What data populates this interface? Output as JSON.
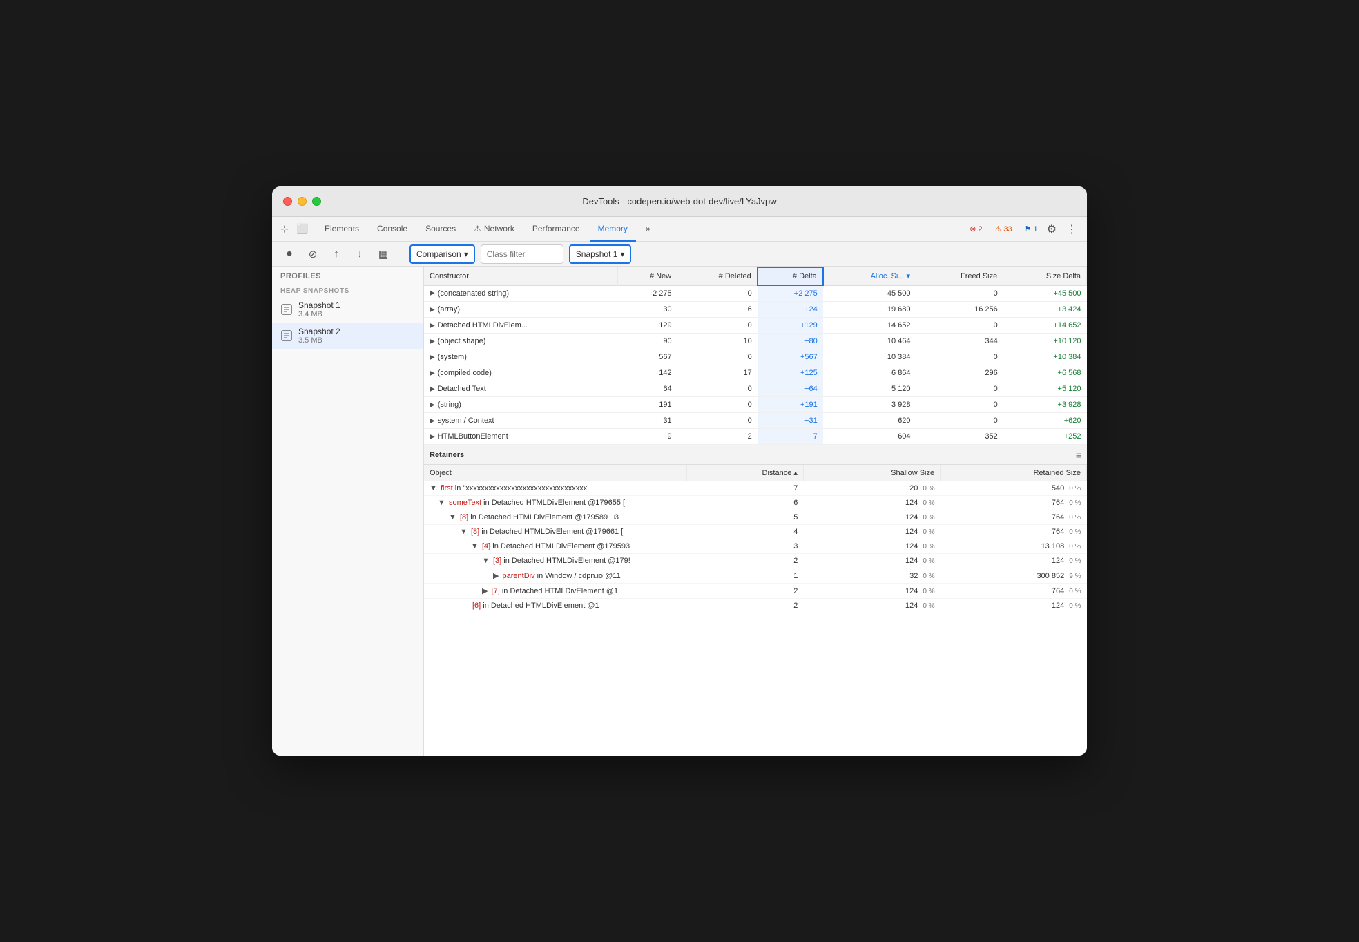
{
  "window": {
    "title": "DevTools - codepen.io/web-dot-dev/live/LYaJvpw"
  },
  "tabs": [
    {
      "label": "Elements",
      "active": false
    },
    {
      "label": "Console",
      "active": false
    },
    {
      "label": "Sources",
      "active": false
    },
    {
      "label": "⚠ Network",
      "active": false,
      "has_warning": true
    },
    {
      "label": "Performance",
      "active": false
    },
    {
      "label": "Memory",
      "active": true
    },
    {
      "label": "»",
      "active": false
    }
  ],
  "badges": {
    "error": "2",
    "warning": "33",
    "info": "1"
  },
  "toolbar": {
    "comparison_label": "Comparison",
    "class_filter_placeholder": "Class filter",
    "snapshot_label": "Snapshot 1"
  },
  "table": {
    "headers": [
      "Constructor",
      "# New",
      "# Deleted",
      "# Delta",
      "Alloc. Si...",
      "Freed Size",
      "Size Delta"
    ],
    "rows": [
      {
        "constructor": "(concatenated string)",
        "new": "2 275",
        "deleted": "0",
        "delta": "+2 275",
        "alloc_size": "45 500",
        "freed_size": "0",
        "size_delta": "+45 500"
      },
      {
        "constructor": "(array)",
        "new": "30",
        "deleted": "6",
        "delta": "+24",
        "alloc_size": "19 680",
        "freed_size": "16 256",
        "size_delta": "+3 424"
      },
      {
        "constructor": "Detached HTMLDivElem...",
        "new": "129",
        "deleted": "0",
        "delta": "+129",
        "alloc_size": "14 652",
        "freed_size": "0",
        "size_delta": "+14 652"
      },
      {
        "constructor": "(object shape)",
        "new": "90",
        "deleted": "10",
        "delta": "+80",
        "alloc_size": "10 464",
        "freed_size": "344",
        "size_delta": "+10 120"
      },
      {
        "constructor": "(system)",
        "new": "567",
        "deleted": "0",
        "delta": "+567",
        "alloc_size": "10 384",
        "freed_size": "0",
        "size_delta": "+10 384"
      },
      {
        "constructor": "(compiled code)",
        "new": "142",
        "deleted": "17",
        "delta": "+125",
        "alloc_size": "6 864",
        "freed_size": "296",
        "size_delta": "+6 568"
      },
      {
        "constructor": "Detached Text",
        "new": "64",
        "deleted": "0",
        "delta": "+64",
        "alloc_size": "5 120",
        "freed_size": "0",
        "size_delta": "+5 120"
      },
      {
        "constructor": "(string)",
        "new": "191",
        "deleted": "0",
        "delta": "+191",
        "alloc_size": "3 928",
        "freed_size": "0",
        "size_delta": "+3 928"
      },
      {
        "constructor": "system / Context",
        "new": "31",
        "deleted": "0",
        "delta": "+31",
        "alloc_size": "620",
        "freed_size": "0",
        "size_delta": "+620"
      },
      {
        "constructor": "HTMLButtonElement",
        "new": "9",
        "deleted": "2",
        "delta": "+7",
        "alloc_size": "604",
        "freed_size": "352",
        "size_delta": "+252"
      }
    ]
  },
  "retainers": {
    "title": "Retainers",
    "headers": [
      "Object",
      "Distance",
      "Shallow Size",
      "Retained Size"
    ],
    "rows": [
      {
        "indent": 0,
        "prefix": "▼",
        "keyword": "first",
        "text": " in \"xxxxxxxxxxxxxxxxxxxxxxxxxxxxxxxx",
        "distance": "7",
        "shallow": "20",
        "shallow_pct": "0 %",
        "retained": "540",
        "retained_pct": "0 %"
      },
      {
        "indent": 1,
        "prefix": "▼",
        "keyword": "someText",
        "text": " in Detached HTMLDivElement @179655 [",
        "distance": "6",
        "shallow": "124",
        "shallow_pct": "0 %",
        "retained": "764",
        "retained_pct": "0 %"
      },
      {
        "indent": 2,
        "prefix": "▼",
        "keyword": "[8]",
        "text": " in Detached HTMLDivElement @179589 □3",
        "distance": "5",
        "shallow": "124",
        "shallow_pct": "0 %",
        "retained": "764",
        "retained_pct": "0 %"
      },
      {
        "indent": 3,
        "prefix": "▼",
        "keyword": "[8]",
        "text": " in Detached HTMLDivElement @179661 [",
        "distance": "4",
        "shallow": "124",
        "shallow_pct": "0 %",
        "retained": "764",
        "retained_pct": "0 %"
      },
      {
        "indent": 4,
        "prefix": "▼",
        "keyword": "[4]",
        "text": " in Detached HTMLDivElement @179593",
        "distance": "3",
        "shallow": "124",
        "shallow_pct": "0 %",
        "retained": "13 108",
        "retained_pct": "0 %"
      },
      {
        "indent": 5,
        "prefix": "▼",
        "keyword": "[3]",
        "text": " in Detached HTMLDivElement @179!",
        "distance": "2",
        "shallow": "124",
        "shallow_pct": "0 %",
        "retained": "124",
        "retained_pct": "0 %"
      },
      {
        "indent": 6,
        "prefix": "▶",
        "keyword": "parentDiv",
        "text": " in Window / cdpn.io @11",
        "distance": "1",
        "shallow": "32",
        "shallow_pct": "0 %",
        "retained": "300 852",
        "retained_pct": "9 %"
      },
      {
        "indent": 5,
        "prefix": "▶",
        "keyword": "[7]",
        "text": " in Detached HTMLDivElement @1",
        "distance": "2",
        "shallow": "124",
        "shallow_pct": "0 %",
        "retained": "764",
        "retained_pct": "0 %"
      },
      {
        "indent": 4,
        "prefix": "",
        "keyword": "[6]",
        "text": " in Detached HTMLDivElement @1",
        "distance": "2",
        "shallow": "124",
        "shallow_pct": "0 %",
        "retained": "124",
        "retained_pct": "0 %"
      }
    ]
  },
  "sidebar": {
    "section_title": "Profiles",
    "subsection_title": "HEAP SNAPSHOTS",
    "snapshots": [
      {
        "name": "Snapshot 1",
        "size": "3.4 MB",
        "active": false
      },
      {
        "name": "Snapshot 2",
        "size": "3.5 MB",
        "active": true
      }
    ]
  }
}
